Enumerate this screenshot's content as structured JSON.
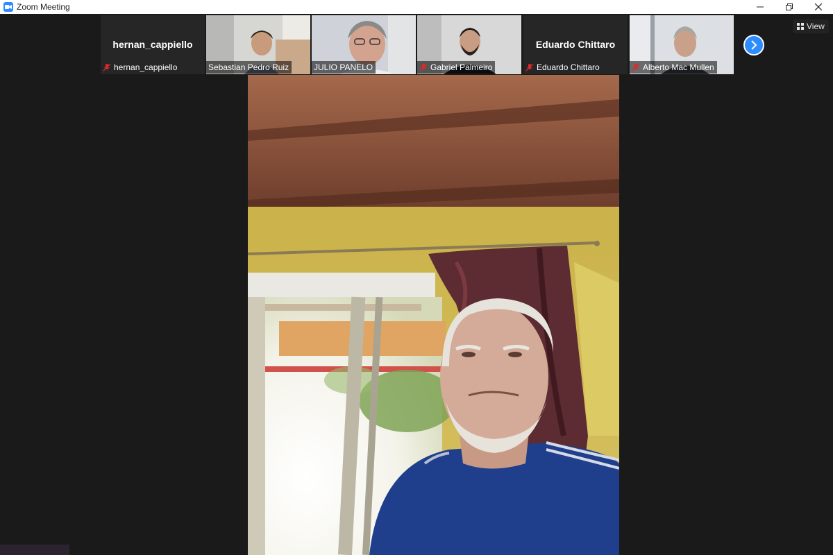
{
  "window": {
    "title": "Zoom Meeting",
    "icon": "zoom-camera-icon",
    "controls": [
      "minimize-icon",
      "restore-icon",
      "close-icon"
    ]
  },
  "toolbar": {
    "view_label": "View"
  },
  "participants": [
    {
      "name": "hernan_cappiello",
      "display_name": "hernan_cappiello",
      "video_on": false,
      "muted": true
    },
    {
      "name": "Sebastian Pedro Ruiz",
      "video_on": true,
      "muted": false
    },
    {
      "name": "JULIO PANELO",
      "video_on": true,
      "muted": false
    },
    {
      "name": "Gabriel Palmeiro",
      "video_on": true,
      "muted": true
    },
    {
      "name": "Eduardo Chittaro",
      "display_name": "Eduardo Chittaro",
      "video_on": false,
      "muted": true
    },
    {
      "name": "Alberto Mac Mullen",
      "video_on": true,
      "muted": true
    }
  ],
  "colors": {
    "accent": "#2d8cff",
    "background": "#1a1a1a",
    "tile": "#262626",
    "mute": "#e02828"
  }
}
